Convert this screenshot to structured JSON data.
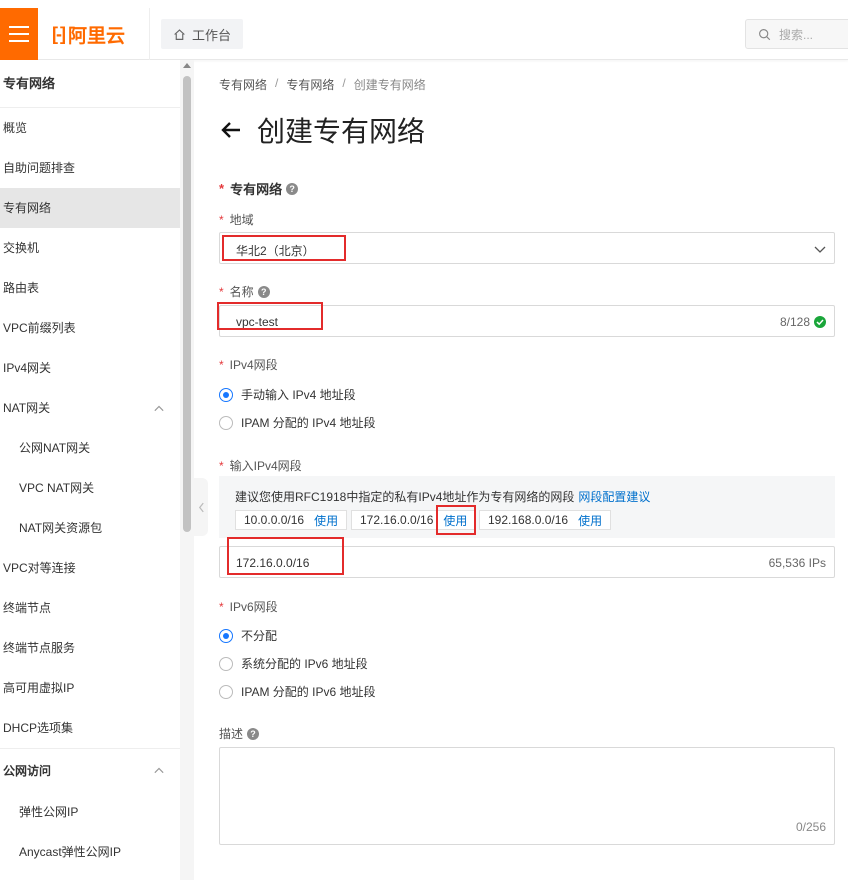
{
  "brand": {
    "name": "阿里云",
    "color": "#ff6a00"
  },
  "topbar": {
    "workbench_label": "工作台",
    "search_placeholder": "搜索..."
  },
  "sidebar": {
    "title": "专有网络",
    "items": [
      {
        "label": "概览"
      },
      {
        "label": "自助问题排查"
      },
      {
        "label": "专有网络",
        "active": true
      },
      {
        "label": "交换机"
      },
      {
        "label": "路由表"
      },
      {
        "label": "VPC前缀列表"
      },
      {
        "label": "IPv4网关"
      },
      {
        "label": "NAT网关",
        "expanded": true
      },
      {
        "label": "公网NAT网关",
        "sub": true
      },
      {
        "label": "VPC NAT网关",
        "sub": true
      },
      {
        "label": "NAT网关资源包",
        "sub": true
      },
      {
        "label": "VPC对等连接"
      },
      {
        "label": "终端节点"
      },
      {
        "label": "终端节点服务"
      },
      {
        "label": "高可用虚拟IP"
      },
      {
        "label": "DHCP选项集"
      }
    ],
    "group": {
      "label": "公网访问",
      "expanded": true
    },
    "group_items": [
      {
        "label": "弹性公网IP"
      },
      {
        "label": "Anycast弹性公网IP"
      }
    ]
  },
  "breadcrumb": {
    "items": [
      "专有网络",
      "专有网络"
    ],
    "current": "创建专有网络",
    "separator": "/"
  },
  "page": {
    "title": "创建专有网络"
  },
  "form": {
    "required_mark": "*",
    "section_title": "专有网络",
    "region": {
      "label": "地域",
      "value": "华北2（北京）"
    },
    "name": {
      "label": "名称",
      "value": "vpc-test",
      "counter": "8/128"
    },
    "ipv4": {
      "label": "IPv4网段",
      "options": [
        {
          "label": "手动输入 IPv4 地址段",
          "selected": true
        },
        {
          "label": "IPAM 分配的 IPv4 地址段",
          "selected": false
        }
      ]
    },
    "ipv4_input": {
      "label": "输入IPv4网段",
      "hint": "建议您使用RFC1918中指定的私有IPv4地址作为专有网络的网段",
      "hint_link": "网段配置建议",
      "suggestions": [
        {
          "cidr": "10.0.0.0/16",
          "action": "使用"
        },
        {
          "cidr": "172.16.0.0/16",
          "action": "使用"
        },
        {
          "cidr": "192.168.0.0/16",
          "action": "使用"
        }
      ],
      "value": "172.16.0.0/16",
      "ip_count": "65,536 IPs"
    },
    "ipv6": {
      "label": "IPv6网段",
      "options": [
        {
          "label": "不分配",
          "selected": true
        },
        {
          "label": "系统分配的 IPv6 地址段",
          "selected": false
        },
        {
          "label": "IPAM 分配的 IPv6 地址段",
          "selected": false
        }
      ]
    },
    "description": {
      "label": "描述",
      "value": "",
      "counter": "0/256"
    }
  },
  "colors": {
    "accent": "#1677ff",
    "link": "#0070cc",
    "highlight": "#e32b2b"
  }
}
